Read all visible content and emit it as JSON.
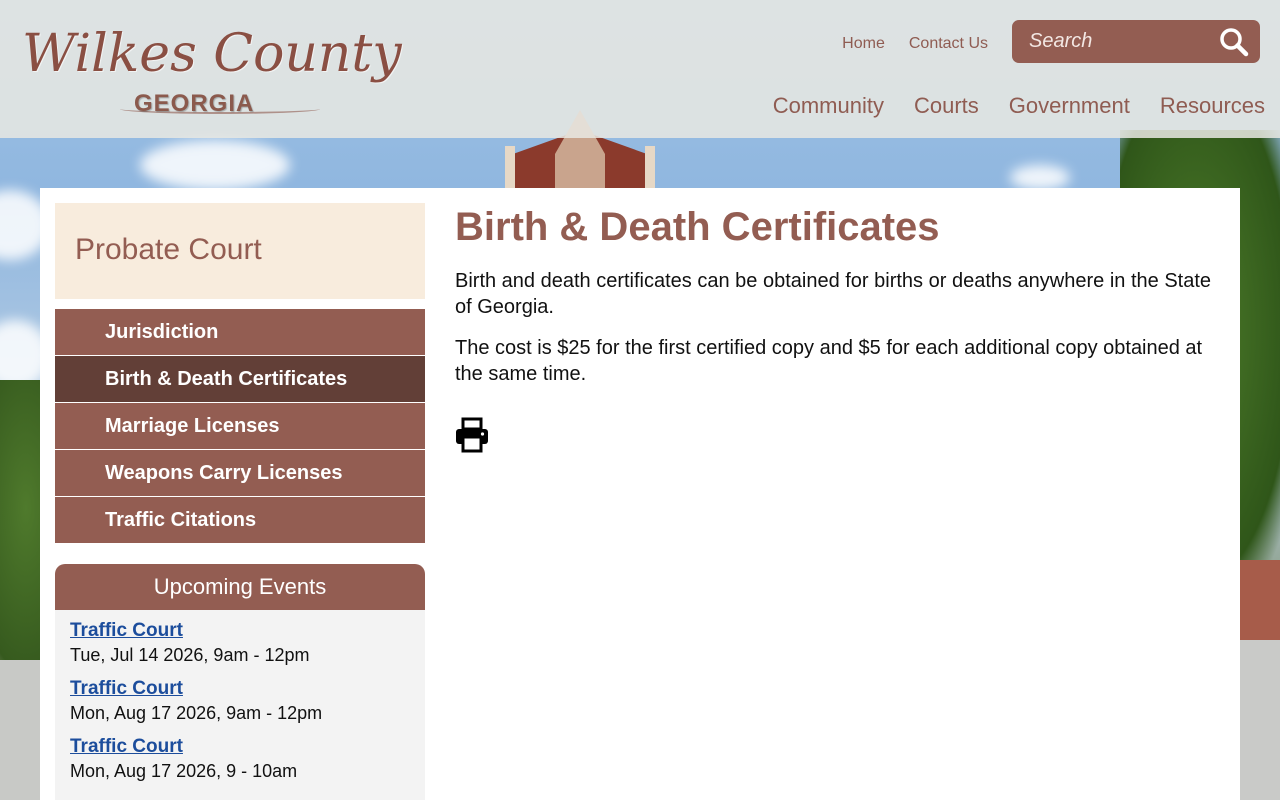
{
  "header": {
    "logo_script": "Wilkes County",
    "logo_sub": "GEORGIA",
    "util_nav": [
      "Home",
      "Contact Us"
    ],
    "search_placeholder": "Search",
    "main_nav": [
      "Community",
      "Courts",
      "Government",
      "Resources"
    ]
  },
  "sidebar": {
    "title": "Probate Court",
    "items": [
      {
        "label": "Jurisdiction",
        "active": false
      },
      {
        "label": "Birth & Death Certificates",
        "active": true
      },
      {
        "label": "Marriage Licenses",
        "active": false
      },
      {
        "label": "Weapons Carry Licenses",
        "active": false
      },
      {
        "label": "Traffic Citations",
        "active": false
      }
    ]
  },
  "events": {
    "heading": "Upcoming Events",
    "items": [
      {
        "title": "Traffic Court",
        "date": "Tue, Jul 14 2026, 9am - 12pm"
      },
      {
        "title": "Traffic Court",
        "date": "Mon, Aug 17 2026, 9am - 12pm"
      },
      {
        "title": "Traffic Court",
        "date": "Mon, Aug 17 2026, 9 - 10am"
      }
    ]
  },
  "content": {
    "title": "Birth & Death Certificates",
    "paragraphs": [
      "Birth and death certificates can be obtained for births or deaths anywhere in the State of Georgia.",
      "The cost is $25 for the first certified copy and $5 for each additional copy obtained at the same time."
    ],
    "print_icon": "printer-icon"
  },
  "colors": {
    "brand": "#935d52",
    "brand_dark": "#623f37",
    "side_title_bg": "#f8ecdd",
    "event_link": "#1c4d9c"
  }
}
